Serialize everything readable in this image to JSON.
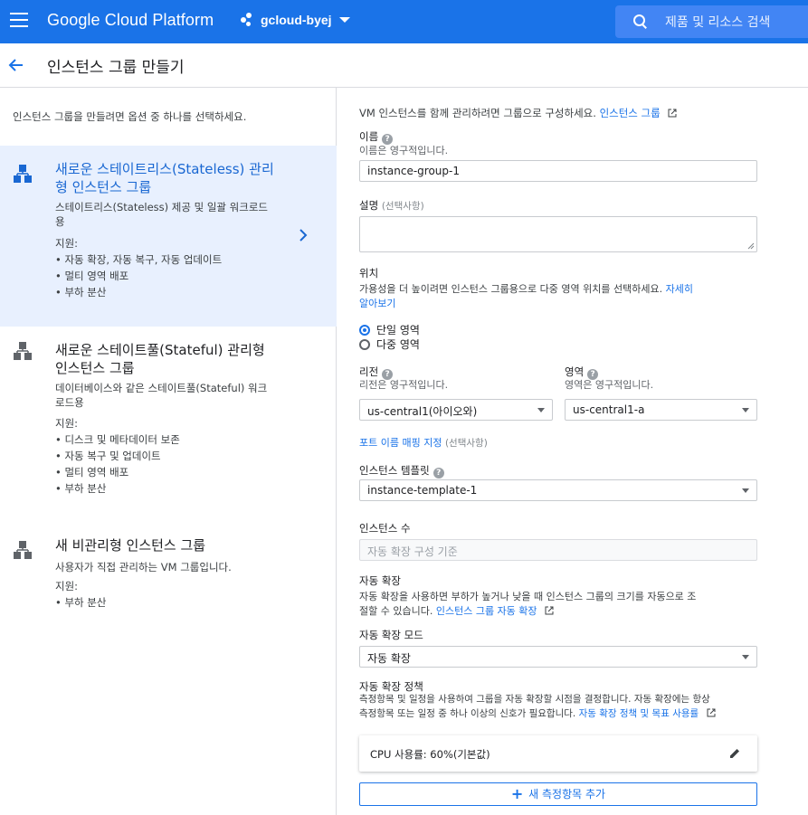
{
  "header": {
    "brand": "Google Cloud Platform",
    "project": "gcloud-byej",
    "search_placeholder": "제품 및 리소스 검색"
  },
  "titlebar": {
    "title": "인스턴스 그룹 만들기"
  },
  "left": {
    "intro": "인스턴스 그룹을 만들려면 옵션 중 하나를 선택하세요.",
    "options": [
      {
        "title": "새로운 스테이트리스(Stateless) 관리형 인스턴스 그룹",
        "desc": "스테이트리스(Stateless) 제공 및 일괄 워크로드용",
        "support_label": "지원:",
        "support": [
          "• 자동 확장, 자동 복구, 자동 업데이트",
          "• 멀티 영역 배포",
          "• 부하 분산"
        ]
      },
      {
        "title": "새로운 스테이트풀(Stateful) 관리형 인스턴스 그룹",
        "desc": "데이터베이스와 같은 스테이트풀(Stateful) 워크로드용",
        "support_label": "지원:",
        "support": [
          "• 디스크 및 메타데이터 보존",
          "• 자동 복구 및 업데이트",
          "• 멀티 영역 배포",
          "• 부하 분산"
        ]
      },
      {
        "title": "새 비관리형 인스턴스 그룹",
        "desc": "사용자가 직접 관리하는 VM 그룹입니다.",
        "support_label": "지원:",
        "support": [
          "• 부하 분산"
        ]
      }
    ]
  },
  "form": {
    "intro": "VM 인스턴스를 함께 관리하려면 그룹으로 구성하세요.",
    "intro_link": "인스턴스 그룹",
    "name_label": "이름",
    "name_sub": "이름은 영구적입니다.",
    "name_value": "instance-group-1",
    "desc_label": "설명",
    "optional": "(선택사항)",
    "location_label": "위치",
    "location_desc": "가용성을 더 높이려면 인스턴스 그룹용으로 다중 영역 위치를 선택하세요.",
    "location_link_1": "자세히",
    "location_link_2": "알아보기",
    "radio_single": "단일 영역",
    "radio_multi": "다중 영역",
    "region_label": "리전",
    "region_sub": "리전은 영구적입니다.",
    "region_value": "us-central1(아이오와)",
    "zone_label": "영역",
    "zone_sub": "영역은 영구적입니다.",
    "zone_value": "us-central1-a",
    "port_link": "포트 이름 매핑 지정",
    "template_label": "인스턴스 템플릿",
    "template_value": "instance-template-1",
    "count_label": "인스턴스 수",
    "count_placeholder": "자동 확장 구성 기준",
    "autoscale_label": "자동 확장",
    "autoscale_desc_1": "자동 확장을 사용하면 부하가 높거나 낮을 때 인스턴스 그룹의 크기를 자동으로 조",
    "autoscale_desc_2": "절할 수 있습니다.",
    "autoscale_link": "인스턴스 그룹 자동 확장",
    "mode_label": "자동 확장 모드",
    "mode_value": "자동 확장",
    "policy_label": "자동 확장 정책",
    "policy_desc_1": "측정항목 및 일정을 사용하여 그룹을 자동 확장할 시점을 결정합니다. 자동 확장에는 항상",
    "policy_desc_2": "측정항목 또는 일정 중 하나 이상의 신호가 필요합니다.",
    "policy_link": "자동 확장 정책 및 목표 사용률",
    "cpu_text": "CPU 사용률: 60%(기본값)",
    "add_metric": "새 측정항목 추가"
  }
}
